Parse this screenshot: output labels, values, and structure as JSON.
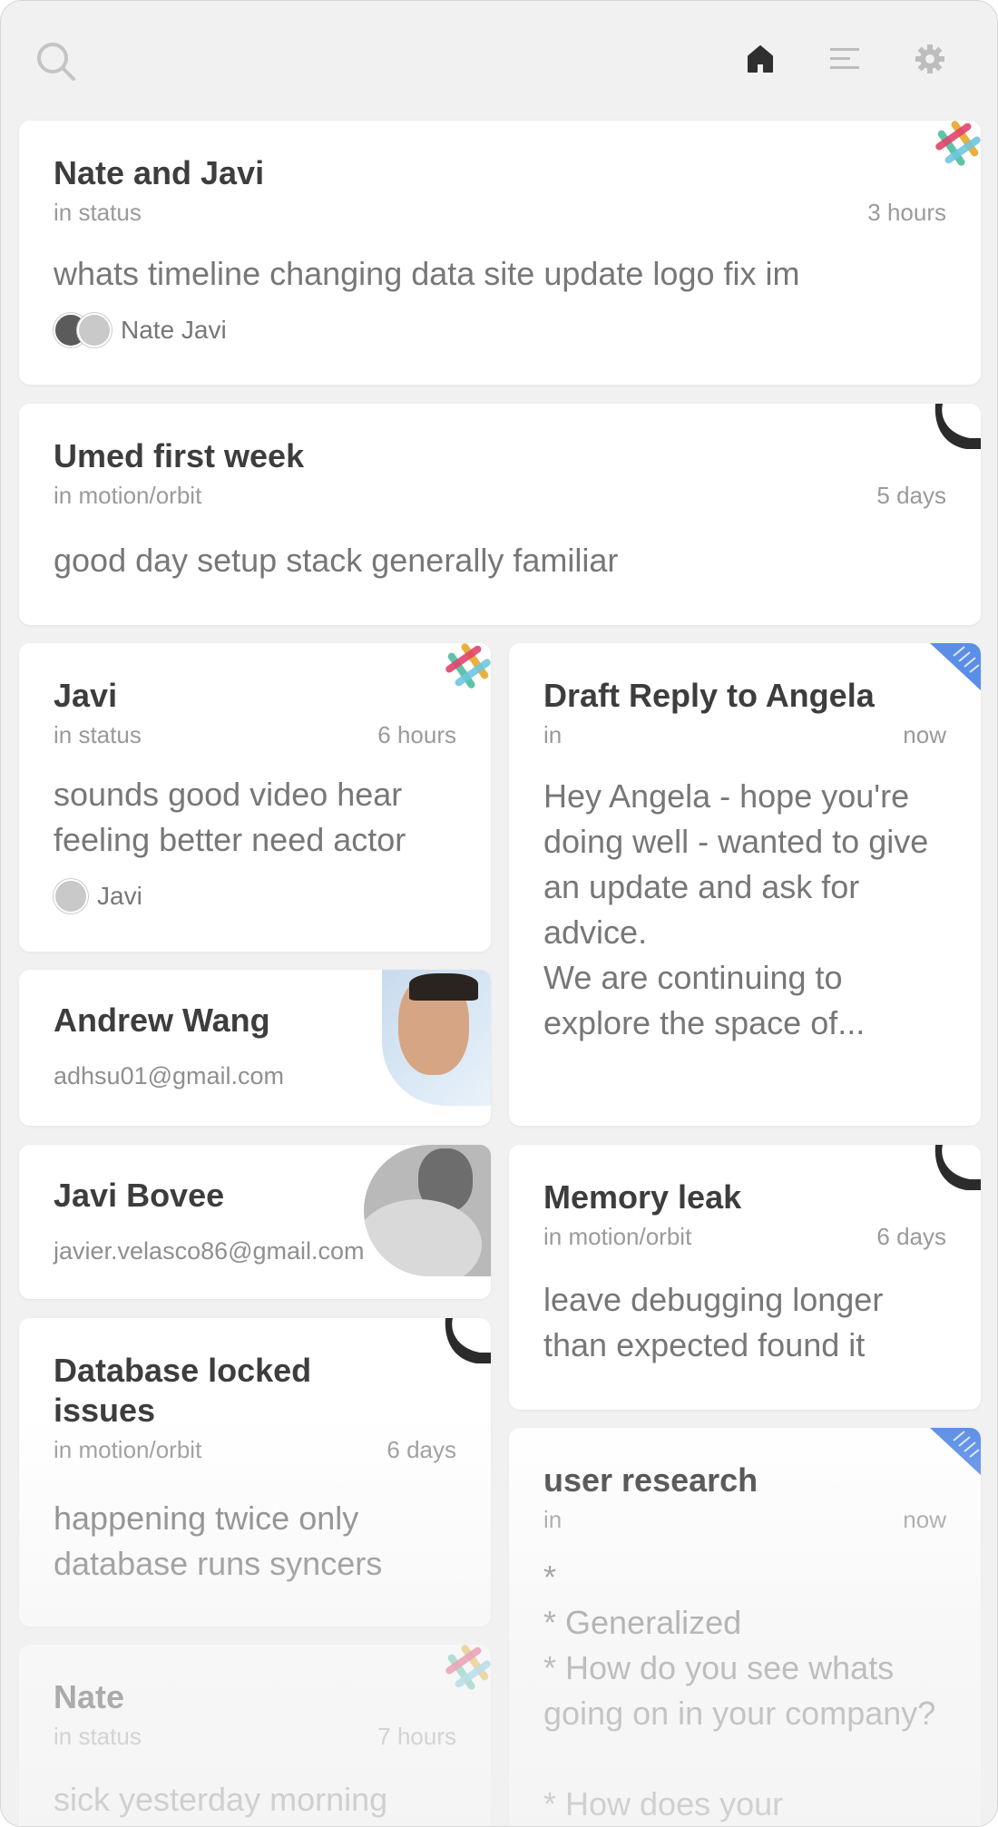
{
  "toolbar": {
    "search_icon": "search-icon",
    "home_icon": "home-icon",
    "menu_icon": "menu-icon",
    "settings_icon": "gear-icon"
  },
  "cards": {
    "nate_javi": {
      "title": "Nate and Javi",
      "channel": "in status",
      "time": "3 hours",
      "body": "whats timeline changing data site update logo fix im",
      "people": "Nate Javi",
      "source_icon": "slack-icon"
    },
    "umed": {
      "title": "Umed first week",
      "channel": "in motion/orbit",
      "time": "5 days",
      "body": "good day setup stack generally familiar",
      "source_icon": "phone-icon"
    },
    "javi": {
      "title": "Javi",
      "channel": "in status",
      "time": "6 hours",
      "body": "sounds good video hear feeling better need actor",
      "people": "Javi",
      "source_icon": "slack-icon"
    },
    "draft_reply": {
      "title": "Draft Reply to Angela",
      "channel": "in",
      "time": "now",
      "body_p1": "Hey Angela - hope you're doing well - wanted to give an update and ask for advice.",
      "body_p2": "We are continuing to explore the space of...",
      "source_icon": "note-icon"
    },
    "andrew": {
      "name": "Andrew Wang",
      "email": "adhsu01@gmail.com"
    },
    "javi_bovee": {
      "name": "Javi Bovee",
      "email": "javier.velasco86@gmail.com"
    },
    "memory_leak": {
      "title": "Memory leak",
      "channel": "in motion/orbit",
      "time": "6 days",
      "body": "leave debugging longer than expected found it",
      "source_icon": "phone-icon"
    },
    "database": {
      "title": "Database locked issues",
      "channel": "in motion/orbit",
      "time": "6 days",
      "body": "happening twice only database runs syncers",
      "source_icon": "phone-icon"
    },
    "user_research": {
      "title": "user research",
      "channel": "in",
      "time": "now",
      "lines": [
        "*",
        "* Generalized",
        "* How do you see whats going on in your company?",
        "* How does your"
      ],
      "source_icon": "note-icon"
    },
    "nate": {
      "title": "Nate",
      "channel": "in status",
      "time": "7 hours",
      "body": "sick yesterday morning",
      "source_icon": "slack-icon"
    }
  }
}
